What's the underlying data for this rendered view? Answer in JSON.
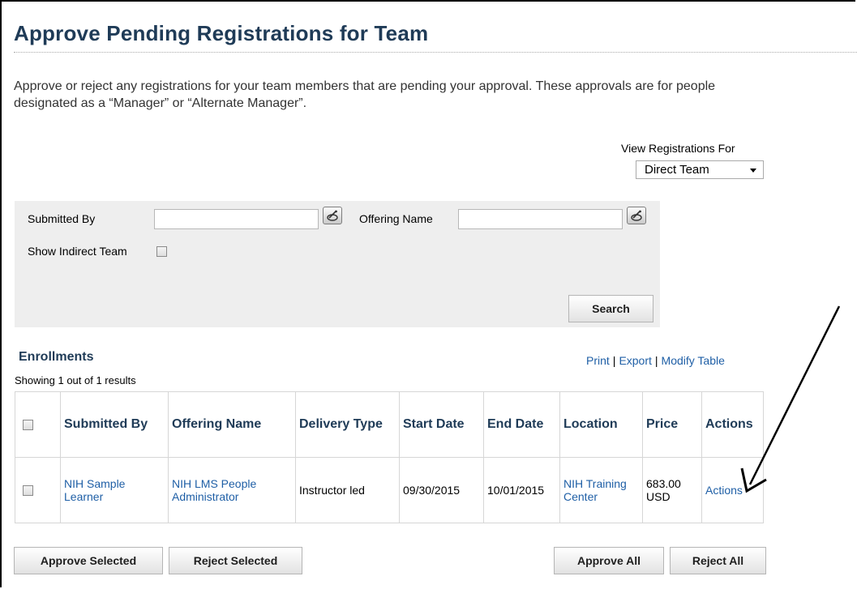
{
  "page": {
    "title": "Approve Pending Registrations for Team",
    "intro_line1": "Approve or reject any registrations for your team members that are pending your approval. These approvals are for people",
    "intro_line2": "designated as a “Manager” or “Alternate Manager”."
  },
  "view": {
    "label": "View Registrations For",
    "selected": "Direct Team"
  },
  "search": {
    "submitted_by_label": "Submitted By",
    "submitted_by_value": "",
    "offering_name_label": "Offering Name",
    "offering_name_value": "",
    "show_indirect_label": "Show Indirect Team",
    "search_button": "Search"
  },
  "enrollments": {
    "title": "Enrollments",
    "showing": "Showing 1 out of 1 results",
    "links": [
      "Print",
      "Export",
      "Modify Table"
    ],
    "columns": [
      "",
      "Submitted By",
      "Offering Name",
      "Delivery Type",
      "Start Date",
      "End Date",
      "Location",
      "Price",
      "Actions"
    ],
    "rows": [
      {
        "submitted_by": "NIH Sample Learner",
        "offering_name": "NIH LMS People Administrator",
        "delivery_type": "Instructor led",
        "start_date": "09/30/2015",
        "end_date": "10/01/2015",
        "location": "NIH Training Center",
        "price": "683.00 USD",
        "actions": "Actions"
      }
    ]
  },
  "buttons": {
    "approve_selected": "Approve Selected",
    "reject_selected": "Reject Selected",
    "approve_all": "Approve All",
    "reject_all": "Reject All"
  },
  "colors": {
    "title": "#1f3b57",
    "link": "#1f5fa6",
    "panel": "#eeeeee"
  }
}
